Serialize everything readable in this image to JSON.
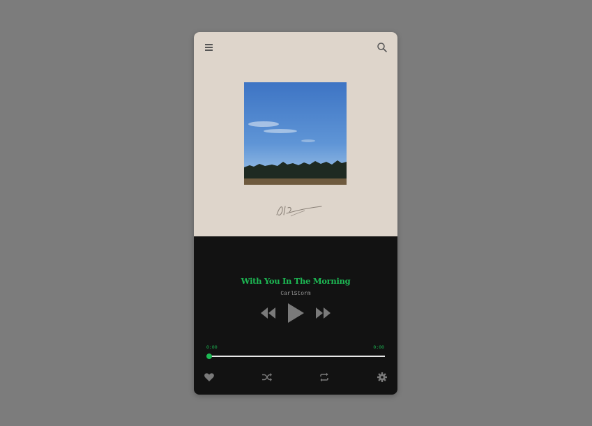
{
  "player": {
    "song_title": "With You In The Morning",
    "artist": "CarlStorm",
    "elapsed": "0:00",
    "duration": "0:00",
    "progress_fraction": 0.0
  },
  "colors": {
    "accent": "#1db954",
    "cover_bg": "#ded5cb",
    "player_bg": "#121212",
    "icon_gray": "#7a7a7a",
    "page_bg": "#7c7c7c"
  },
  "icons": {
    "top_left": "menu-icon",
    "top_right": "search-icon",
    "controls": [
      "rewind-icon",
      "play-icon",
      "fast-forward-icon"
    ],
    "bottom": [
      "heart-icon",
      "shuffle-icon",
      "repeat-icon",
      "gear-icon"
    ]
  }
}
